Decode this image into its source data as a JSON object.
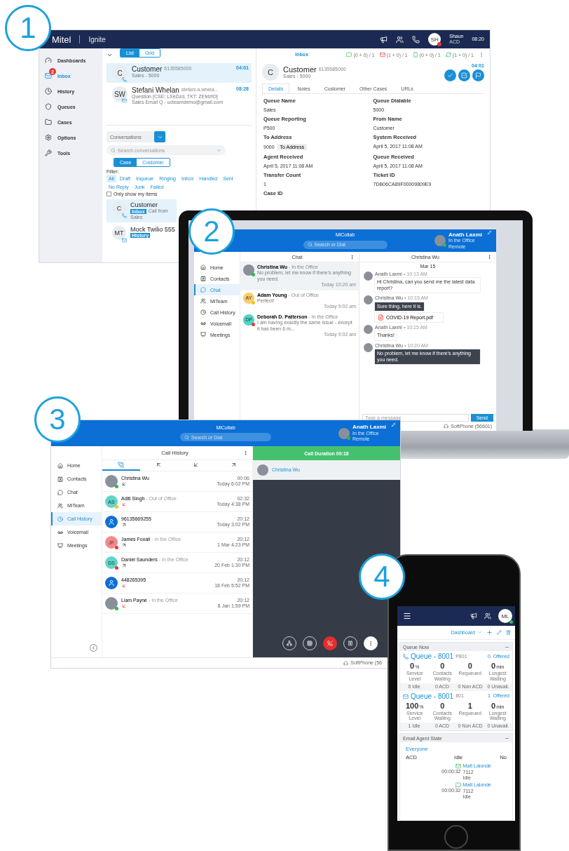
{
  "badges": [
    "1",
    "2",
    "3",
    "4"
  ],
  "ignite": {
    "brand": "Mitel",
    "product": "Ignite",
    "user": {
      "initials": "SH",
      "name": "Shaun",
      "state": "ACD",
      "time": "08:20"
    },
    "nav": [
      {
        "label": "Dashboards",
        "kind": "dashboards",
        "selected": false
      },
      {
        "label": "Inbox",
        "kind": "inbox",
        "selected": true,
        "count": "2"
      },
      {
        "label": "History",
        "kind": "history",
        "selected": false
      },
      {
        "label": "Queues",
        "kind": "queues",
        "selected": false
      },
      {
        "label": "Cases",
        "kind": "cases",
        "selected": false
      },
      {
        "label": "Options",
        "kind": "options",
        "selected": false
      },
      {
        "label": "Tools",
        "kind": "tools",
        "selected": false
      }
    ],
    "views": [
      {
        "label": "List",
        "selected": true
      },
      {
        "label": "Grid",
        "selected": false
      }
    ],
    "inbox": [
      {
        "initials": "C",
        "name": "Customer",
        "detail": "6135585000",
        "lines": [
          "Sales - 5000"
        ],
        "time": "04:01",
        "kind": "phone",
        "selected": true
      },
      {
        "initials": "SW",
        "name": "Stefani Whelan",
        "detail": "stefani.a.whela...",
        "lines": [
          "Question [CSE: LXeDzd, TKT: ZEMzfO]",
          "Sales Email Q - ucteamdemo@gmail.com"
        ],
        "time": "08:28",
        "kind": "email",
        "selected": false
      }
    ],
    "conversations_menu": "Conversations",
    "search": {
      "placeholder": "Search conversations"
    },
    "scopes": [
      {
        "label": "Case",
        "selected": true
      },
      {
        "label": "Customer",
        "selected": false
      }
    ],
    "filter_label": "Filter:",
    "filters": [
      {
        "label": "All",
        "selected": true
      },
      {
        "label": "Draft",
        "selected": false
      },
      {
        "label": "Inqueue",
        "selected": false
      },
      {
        "label": "Ringing",
        "selected": false
      },
      {
        "label": "Inbox",
        "selected": false
      },
      {
        "label": "Handled",
        "selected": false
      },
      {
        "label": "Sent",
        "selected": false
      },
      {
        "label": "No Reply",
        "selected": false
      },
      {
        "label": "Junk",
        "selected": false
      },
      {
        "label": "Failed",
        "selected": false
      }
    ],
    "only_mine": {
      "label": "Only show my items",
      "checked": false
    },
    "conversations": [
      {
        "initials": "C",
        "name": "Customer",
        "tag": "Inbox",
        "text": "Call from",
        "sub": "Sales",
        "kind": "phone"
      },
      {
        "initials": "MT",
        "name": "Mock Twilio 555",
        "tag": "History",
        "kind": "email"
      }
    ],
    "detail": {
      "heading": "Inbox",
      "counters": [
        {
          "kind": "chat",
          "text": "(0 + 0) / 1"
        },
        {
          "kind": "email",
          "text": "(1 + 0) / 1"
        },
        {
          "kind": "sms",
          "text": "(0 + 0) / 1"
        },
        {
          "kind": "callback",
          "text": "(1 + 0) / 1"
        }
      ],
      "initials": "C",
      "name": "Customer",
      "number": "6135585000",
      "sub": "Sales - 5000",
      "time": "04:01",
      "tabs": [
        {
          "label": "Details",
          "selected": true
        },
        {
          "label": "Notes",
          "selected": false
        },
        {
          "label": "Customer",
          "selected": false
        },
        {
          "label": "Other Cases",
          "selected": false
        },
        {
          "label": "URLs",
          "selected": false
        }
      ],
      "fields": [
        {
          "label": "Queue Name",
          "value": "Sales"
        },
        {
          "label": "Queue Dialable",
          "value": "5000"
        },
        {
          "label": "Queue Reporting",
          "value": "P500"
        },
        {
          "label": "From Name",
          "value": "Customer"
        },
        {
          "label": "To Address",
          "value": "9000",
          "action": "To Address"
        },
        {
          "label": "System Received",
          "value": "April 5, 2017 11:08 AM"
        },
        {
          "label": "Agent Received",
          "value": "April 5, 2017 11:08 AM"
        },
        {
          "label": "Queue Received",
          "value": "April 5, 2017 11:08 AM"
        },
        {
          "label": "Transfer Count",
          "value": "1"
        },
        {
          "label": "Ticket ID",
          "value": "7DB06CA89F00009809E9"
        },
        {
          "label": "Case ID"
        }
      ]
    }
  },
  "micollab_chat": {
    "title": "MiCollab",
    "search": {
      "placeholder": "Search or Dial"
    },
    "user": {
      "name": "Anath Laxmi",
      "status": "In the Office",
      "location": "Remote"
    },
    "nav": [
      {
        "label": "Home",
        "kind": "home",
        "selected": false
      },
      {
        "label": "Contacts",
        "kind": "contacts",
        "selected": false
      },
      {
        "label": "Chat",
        "kind": "chat",
        "selected": true
      },
      {
        "label": "MiTeam",
        "kind": "team",
        "selected": false
      },
      {
        "label": "Call History",
        "kind": "history",
        "selected": false
      },
      {
        "label": "Voicemail",
        "kind": "voicemail",
        "selected": false
      },
      {
        "label": "Meetings",
        "kind": "meetings",
        "selected": false
      }
    ],
    "list_title": "Chat",
    "chats": [
      {
        "name": "Christina Wu",
        "status": "- In the Office",
        "preview": "No problem, let me know if there's anything you need.",
        "time": "Today 10:20 am",
        "avatar": {
          "kind": "photo"
        },
        "color": "#2db84d",
        "selected": true
      },
      {
        "name": "Adam Young",
        "status": "- Out of Office",
        "preview": "Perfect!",
        "time": "Today 9:02 am",
        "avatar": {
          "kind": "initials",
          "text": "AY"
        },
        "color": "#f5c518",
        "selected": false
      },
      {
        "name": "Deborah D. Patterson",
        "status": "- In the Office",
        "preview": "I am having exactly the same issue - except it has been 6 m...",
        "time": "Today 9:02 am",
        "avatar": {
          "kind": "initials",
          "text": "DP"
        },
        "color": "#e53935",
        "selected": false
      }
    ],
    "conversation": {
      "title": "Christina Wu",
      "date": "Mar 15",
      "messages": [
        {
          "author": "Anath Laxmi",
          "time": "• 10:13 AM",
          "text": "Hi Christina, can you send me the latest data report?",
          "own": true
        },
        {
          "author": "Christina Wu",
          "time": "• 10:15 AM",
          "text": "Sure thing, here it is.",
          "own": false,
          "attachment": "COVID-19 Report.pdf"
        },
        {
          "author": "Anath Laxmi",
          "time": "• 10:15 AM",
          "text": "Thanks!",
          "own": true
        },
        {
          "author": "Christina Wu",
          "time": "• 10:20 AM",
          "text": "No problem, let me know if there's anything you need.",
          "own": false
        }
      ],
      "input": {
        "placeholder": "Type a message"
      },
      "send": "Send",
      "softphone": "SoftPhone (56601)"
    }
  },
  "micollab_calls": {
    "title": "MiCollab",
    "search": {
      "placeholder": "Search or Dial"
    },
    "user": {
      "name": "Anath Laxmi",
      "status": "In the Office",
      "location": "Remote"
    },
    "nav": [
      {
        "label": "Home",
        "kind": "home",
        "selected": false
      },
      {
        "label": "Contacts",
        "kind": "contacts",
        "selected": false
      },
      {
        "label": "Chat",
        "kind": "chat",
        "selected": false
      },
      {
        "label": "MiTeam",
        "kind": "team",
        "selected": false
      },
      {
        "label": "Call History",
        "kind": "history",
        "selected": true
      },
      {
        "label": "Voicemail",
        "kind": "voicemail",
        "selected": false
      },
      {
        "label": "Meetings",
        "kind": "meetings",
        "selected": false
      }
    ],
    "list_title": "Call History",
    "tabs": [
      {
        "kind": "all",
        "selected": true
      },
      {
        "kind": "missed",
        "selected": false
      },
      {
        "kind": "incoming",
        "selected": false
      },
      {
        "kind": "outgoing",
        "selected": false
      }
    ],
    "calls": [
      {
        "name": "Christina Wu",
        "avatar": {
          "kind": "photo"
        },
        "color": "#2db84d",
        "arrow": {
          "kind": "incoming"
        },
        "duration": "00:06",
        "when": "Today 6:02 PM"
      },
      {
        "name": "Aditi Singh",
        "status": "- Out of Office",
        "avatar": {
          "kind": "initials",
          "text": "AS"
        },
        "color": "#f5c518",
        "arrow": {
          "kind": "missed"
        },
        "duration": "02:32",
        "when": "Today 4:38 PM"
      },
      {
        "name": "96135669255",
        "avatar": {
          "kind": "number"
        },
        "arrow": {
          "kind": "outgoing"
        },
        "duration": "20:12",
        "when": "Today 3:02 PM"
      },
      {
        "name": "James Foxall",
        "status": "- In the Office",
        "avatar": {
          "kind": "initials",
          "text": "JF"
        },
        "color": "#e53935",
        "arrow": {
          "kind": "outgoing"
        },
        "duration": "20:12",
        "when": "1 Mar 4:23 PM"
      },
      {
        "name": "Daniel Saunders",
        "status": "- In the Office",
        "avatar": {
          "kind": "initials",
          "text": "DS"
        },
        "color": "#e53935",
        "arrow": {
          "kind": "outgoing"
        },
        "duration": "20:12",
        "when": "20 Feb 1:30 PM"
      },
      {
        "name": "448265395",
        "avatar": {
          "kind": "number"
        },
        "arrow": {
          "kind": "missed"
        },
        "duration": "20:12",
        "when": "18 Feb 5:52 PM"
      },
      {
        "name": "Liam Payne",
        "status": "- In the Office",
        "avatar": {
          "kind": "photo"
        },
        "color": "#2db84d",
        "arrow": {
          "kind": "missed"
        },
        "duration": "20:12",
        "when": "8 Jan 1:59 PM"
      }
    ],
    "call": {
      "banner": "Call Duration 00:18",
      "caller": "Christina Wu",
      "controls": [
        {
          "kind": "transfer"
        },
        {
          "kind": "keypad"
        },
        {
          "kind": "hangup"
        },
        {
          "kind": "hold"
        },
        {
          "kind": "more"
        }
      ]
    },
    "softphone": "SoftPhone (56"
  },
  "mobile": {
    "initials": "ML",
    "dashboard": "Dashboard",
    "queue_card": {
      "title": "Queue Now",
      "queues": [
        {
          "kind": "phone",
          "name": "Queue - 8001",
          "code": "P801",
          "offered": "0  Offered",
          "stats": [
            {
              "value": "0",
              "unit": "%",
              "label": "Service Level"
            },
            {
              "value": "0",
              "label": "Contacts Waiting"
            },
            {
              "value": "0",
              "label": "Requeued"
            },
            {
              "value": "0",
              "unit": "min",
              "label": "Longest Waiting"
            }
          ],
          "footer": [
            "0 Idle",
            "0 ACD",
            "0 Non ACD",
            "0 Unavail."
          ]
        },
        {
          "kind": "email",
          "name": "Queue - 8001",
          "code": "801",
          "offered": "1  Offered",
          "stats": [
            {
              "value": "100",
              "unit": "%",
              "label": "Service Level"
            },
            {
              "value": "0",
              "label": "Contacts Waiting"
            },
            {
              "value": "1",
              "label": "Requeued"
            },
            {
              "value": "0",
              "unit": "min",
              "label": "Longest Waiting"
            }
          ],
          "footer": [
            "1 Idle",
            "0 ACD",
            "0 Non ACD",
            "0 Unavail."
          ]
        }
      ]
    },
    "agent_card": {
      "title": "Email Agent State",
      "group": "Everyone",
      "columns": [
        "ACD",
        "Idle",
        "No"
      ],
      "agents": [
        {
          "kind": "email",
          "name": "Matt Lalonde",
          "ext": "7112",
          "timer": "00:00:32",
          "state": "Idle"
        },
        {
          "kind": "chat",
          "name": "Matt Lalonde",
          "ext": "7112",
          "timer": "00:00:32",
          "state": "Idle"
        }
      ]
    }
  }
}
